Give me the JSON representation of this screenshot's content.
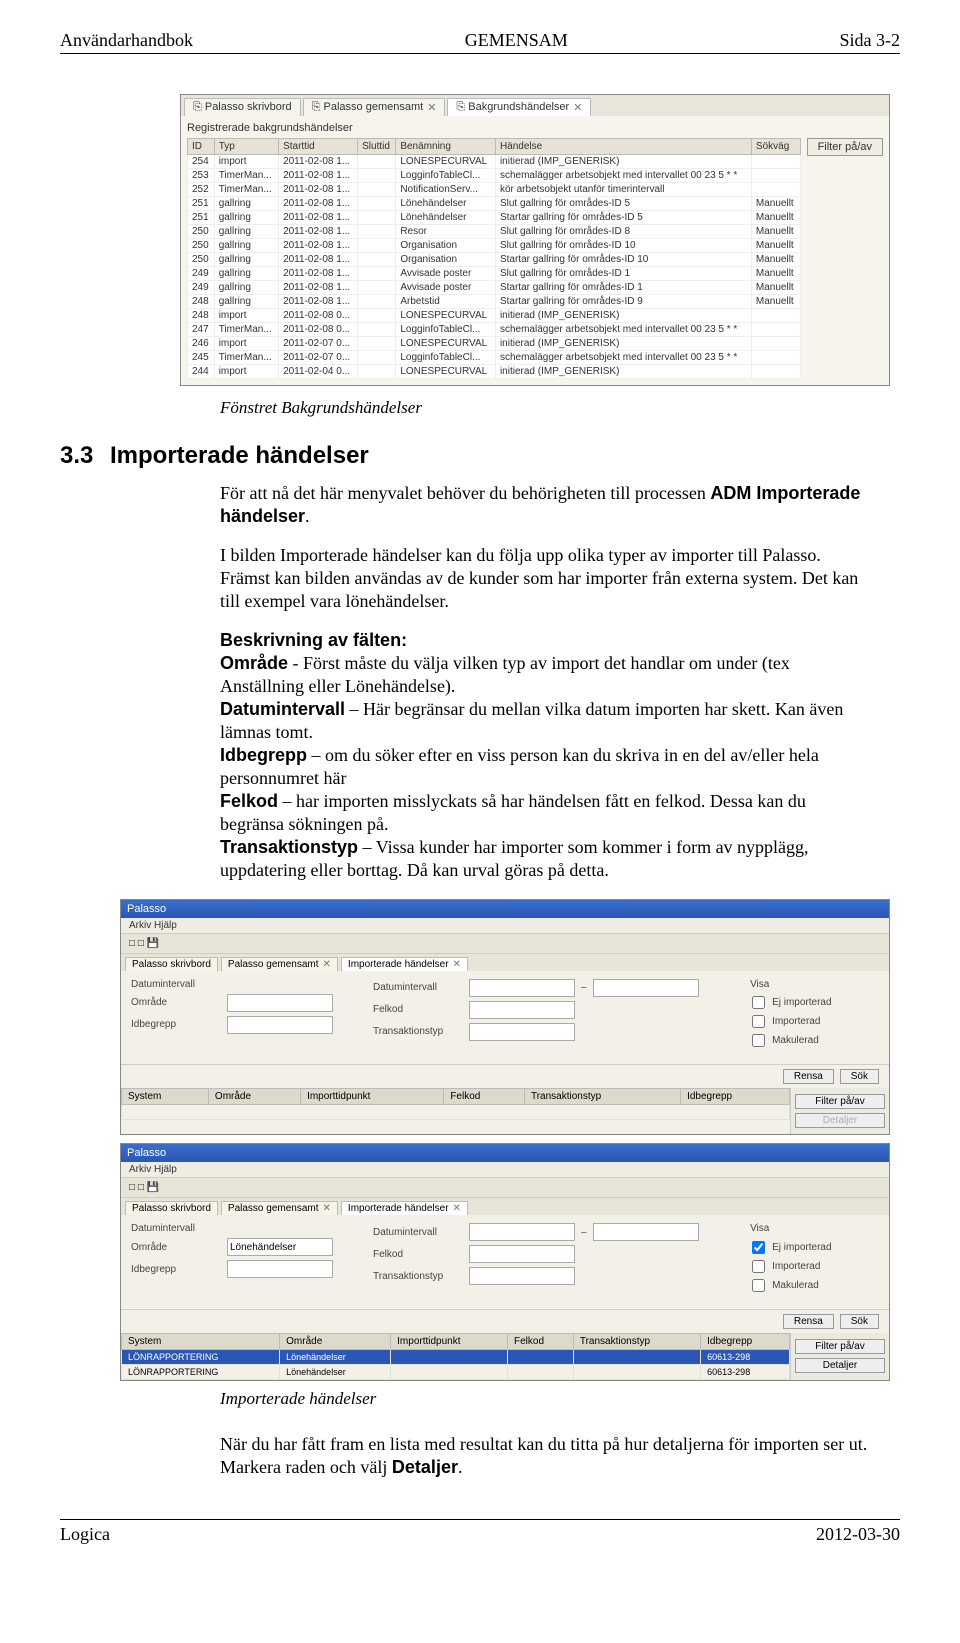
{
  "header": {
    "left": "Användarhandbok",
    "center": "GEMENSAM",
    "right": "Sida 3-2"
  },
  "footer": {
    "left": "Logica",
    "right": "2012-03-30"
  },
  "screenshot1": {
    "tabs": [
      "Palasso skrivbord",
      "Palasso gemensamt",
      "Bakgrundshändelser"
    ],
    "tabCloseIdx": [
      1,
      2
    ],
    "subtitle": "Registrerade bakgrundshändelser",
    "filterBtn": "Filter på/av",
    "columns": [
      "ID",
      "Typ",
      "Starttid",
      "Sluttid",
      "Benämning",
      "Händelse",
      "Sökväg"
    ],
    "rows": [
      [
        "254",
        "import",
        "2011-02-08 1...",
        "",
        "LONESPECURVAL",
        "initierad (IMP_GENERISK)",
        ""
      ],
      [
        "253",
        "TimerMan...",
        "2011-02-08 1...",
        "",
        "LogginfoTableCl...",
        "schemalägger arbetsobjekt med intervallet 00 23 5 * *",
        ""
      ],
      [
        "252",
        "TimerMan...",
        "2011-02-08 1...",
        "",
        "NotificationServ...",
        "kör arbetsobjekt utanför timerintervall",
        ""
      ],
      [
        "251",
        "gallring",
        "2011-02-08 1...",
        "",
        "Lönehändelser",
        "Slut gallring för områdes-ID 5",
        "Manuellt"
      ],
      [
        "251",
        "gallring",
        "2011-02-08 1...",
        "",
        "Lönehändelser",
        "Startar gallring för områdes-ID 5",
        "Manuellt"
      ],
      [
        "250",
        "gallring",
        "2011-02-08 1...",
        "",
        "Resor",
        "Slut gallring för områdes-ID 8",
        "Manuellt"
      ],
      [
        "250",
        "gallring",
        "2011-02-08 1...",
        "",
        "Organisation",
        "Slut gallring för områdes-ID 10",
        "Manuellt"
      ],
      [
        "250",
        "gallring",
        "2011-02-08 1...",
        "",
        "Organisation",
        "Startar gallring för områdes-ID 10",
        "Manuellt"
      ],
      [
        "249",
        "gallring",
        "2011-02-08 1...",
        "",
        "Avvisade poster",
        "Slut gallring för områdes-ID 1",
        "Manuellt"
      ],
      [
        "249",
        "gallring",
        "2011-02-08 1...",
        "",
        "Avvisade poster",
        "Startar gallring för områdes-ID 1",
        "Manuellt"
      ],
      [
        "248",
        "gallring",
        "2011-02-08 1...",
        "",
        "Arbetstid",
        "Startar gallring för områdes-ID 9",
        "Manuellt"
      ],
      [
        "248",
        "import",
        "2011-02-08 0...",
        "",
        "LONESPECURVAL",
        "initierad (IMP_GENERISK)",
        ""
      ],
      [
        "247",
        "TimerMan...",
        "2011-02-08 0...",
        "",
        "LogginfoTableCl...",
        "schemalägger arbetsobjekt med intervallet 00 23 5 * *",
        ""
      ],
      [
        "246",
        "import",
        "2011-02-07 0...",
        "",
        "LONESPECURVAL",
        "initierad (IMP_GENERISK)",
        ""
      ],
      [
        "245",
        "TimerMan...",
        "2011-02-07 0...",
        "",
        "LogginfoTableCl...",
        "schemalägger arbetsobjekt med intervallet 00 23 5 * *",
        ""
      ],
      [
        "244",
        "import",
        "2011-02-04 0...",
        "",
        "LONESPECURVAL",
        "initierad (IMP_GENERISK)",
        ""
      ]
    ]
  },
  "caption1": "Fönstret Bakgrundshändelser",
  "section": {
    "num": "3.3",
    "title": "Importerade händelser"
  },
  "para1_a": "För att nå det här menyvalet behöver du behörigheten till processen ",
  "para1_b": "ADM Importerade händelser",
  "para1_c": ".",
  "para2": "I bilden Importerade händelser kan du följa upp olika typer av importer till Palasso. Främst kan bilden användas av de kunder som har importer från externa system. Det kan till exempel vara lönehändelser.",
  "beskr_title": "Beskrivning av fälten:",
  "fld1_name": "Område",
  "fld1_text": " - Först måste du välja vilken typ av import det handlar om under (tex Anställning eller Lönehändelse).",
  "fld2_name": "Datumintervall",
  "fld2_text": " – Här begränsar du mellan vilka datum importen har skett. Kan även lämnas tomt.",
  "fld3_name": "Idbegrepp",
  "fld3_text": " – om du söker efter en viss person kan du skriva in en del av/eller hela personnumret här",
  "fld4_name": "Felkod",
  "fld4_text": " – har importen misslyckats så har händelsen fått en felkod. Dessa kan du begränsa sökningen på.",
  "fld5_name": "Transaktionstyp",
  "fld5_text": " – Vissa kunder har importer som kommer i form av nypplägg, uppdatering eller borttag. Då kan urval göras på detta.",
  "screenshot2": {
    "title": "Palasso",
    "menu": "Arkiv  Hjälp",
    "tabs": [
      "Palasso skrivbord",
      "Palasso gemensamt",
      "Importerade händelser"
    ],
    "form": {
      "col1": [
        {
          "label": "Datumintervall"
        },
        {
          "label": "Område"
        },
        {
          "label": "Lönehändelser"
        },
        {
          "label": "Idbegrepp"
        }
      ],
      "col2": [
        {
          "label": "Datumintervall"
        },
        {
          "label": "Felkod"
        },
        {
          "label": "Transaktionstyp"
        }
      ],
      "visaLegend": "Visa",
      "visa": [
        "Ej importerad",
        "Importerad",
        "Makulerad"
      ]
    },
    "btns": [
      "Rensa",
      "Sök"
    ],
    "resultCols": [
      "System",
      "Område",
      "Importtidpunkt",
      "Felkod",
      "Transaktionstyp",
      "Idbegrepp"
    ],
    "sideBtns": [
      "Filter på/av",
      "Detaljer"
    ],
    "resultRows2": [
      [
        "LÖNRAPPORTERING",
        "Lönehändelser",
        "",
        "",
        "",
        "60613-298"
      ],
      [
        "LÖNRAPPORTERING",
        "Lönehändelser",
        "",
        "",
        "",
        "60613-298"
      ]
    ]
  },
  "caption2": "Importerade händelser",
  "para3": "När du har fått fram en lista med resultat kan du titta på hur detaljerna för importen ser ut. Markera raden och välj ",
  "para3_bold": "Detaljer",
  "para3_end": "."
}
